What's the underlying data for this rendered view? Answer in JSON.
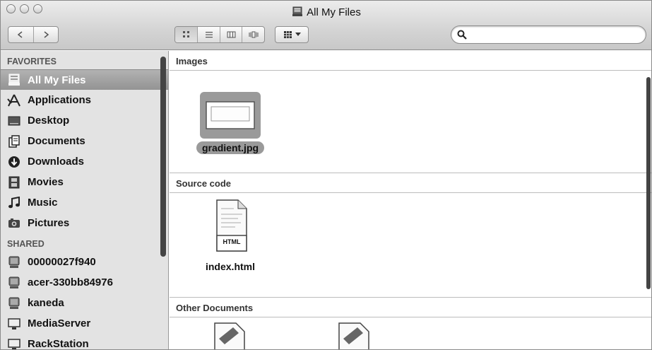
{
  "window": {
    "title": "All My Files"
  },
  "toolbar": {
    "back_label": "◀",
    "forward_label": "▶",
    "search": {
      "value": "",
      "placeholder": ""
    }
  },
  "sidebar": {
    "favorites_header": "FAVORITES",
    "favorites": [
      {
        "label": "All My Files",
        "icon": "all-my-files-icon"
      },
      {
        "label": "Applications",
        "icon": "applications-icon"
      },
      {
        "label": "Desktop",
        "icon": "desktop-icon"
      },
      {
        "label": "Documents",
        "icon": "documents-icon"
      },
      {
        "label": "Downloads",
        "icon": "downloads-icon"
      },
      {
        "label": "Movies",
        "icon": "movies-icon"
      },
      {
        "label": "Music",
        "icon": "music-icon"
      },
      {
        "label": "Pictures",
        "icon": "pictures-icon"
      }
    ],
    "shared_header": "SHARED",
    "shared": [
      {
        "label": "00000027f940",
        "icon": "computer-icon"
      },
      {
        "label": "acer-330bb84976",
        "icon": "computer-icon"
      },
      {
        "label": "kaneda",
        "icon": "computer-icon"
      },
      {
        "label": "MediaServer",
        "icon": "display-icon"
      },
      {
        "label": "RackStation",
        "icon": "display-icon"
      }
    ]
  },
  "content": {
    "sections": [
      {
        "title": "Images",
        "files": [
          {
            "name": "gradient.jpg",
            "selected": true
          }
        ]
      },
      {
        "title": "Source code",
        "files": [
          {
            "name": "index.html",
            "badge": "HTML"
          }
        ]
      },
      {
        "title": "Other Documents",
        "files": []
      }
    ]
  }
}
